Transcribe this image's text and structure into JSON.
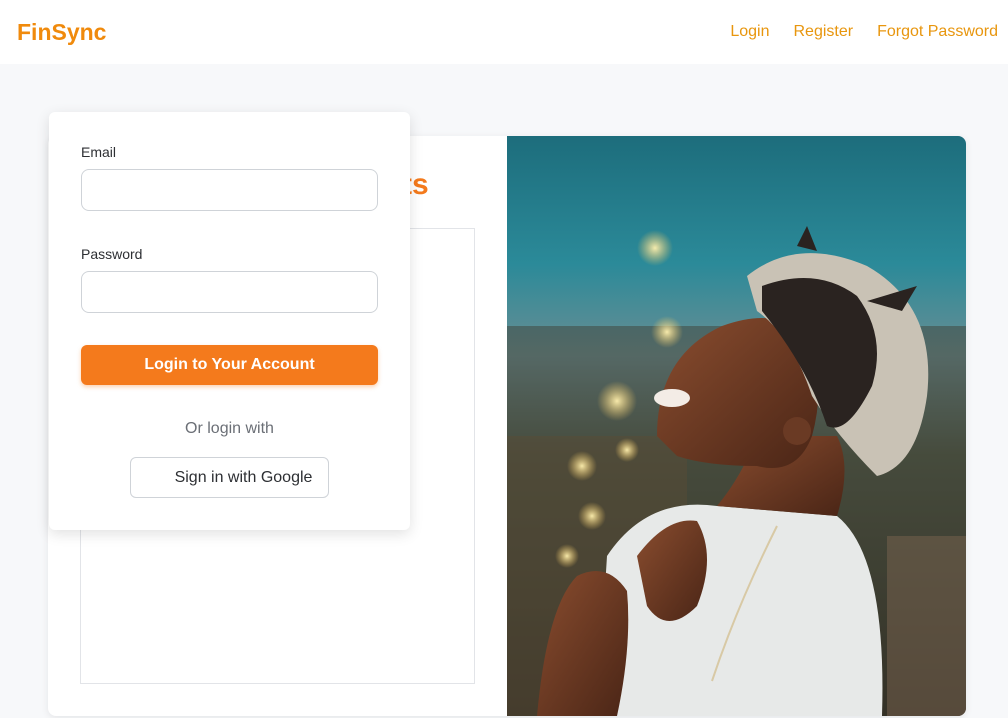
{
  "app": {
    "brand": "FinSync"
  },
  "nav": {
    "login": "Login",
    "register": "Register",
    "forgot_password": "Forgot Password"
  },
  "form": {
    "heading": "Access Your Insights",
    "email_label": "Email",
    "email_value": "",
    "password_label": "Password",
    "password_value": "",
    "submit_label": "Login to Your Account",
    "alt_login_text": "Or login with",
    "google_label": "Sign in with Google"
  },
  "colors": {
    "brand": "#f08a0c",
    "accent": "#f47a1c",
    "nav_link": "#e8960e"
  },
  "icons": {
    "google": "google-icon"
  }
}
